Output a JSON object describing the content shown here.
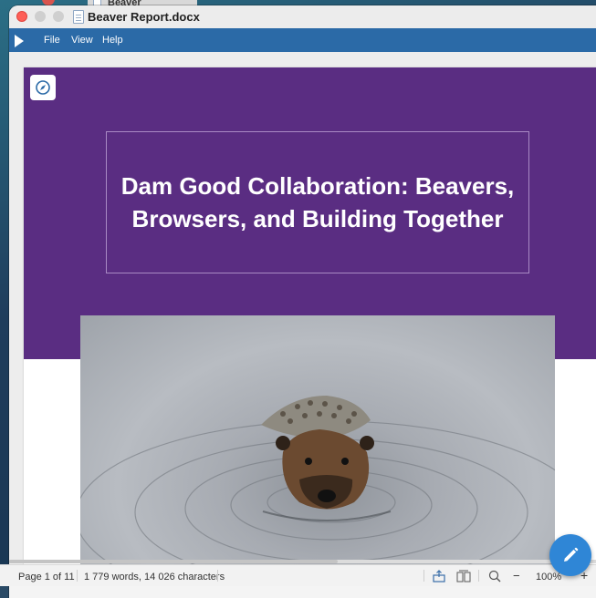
{
  "background_window": {
    "title": "Beaver Report.docx"
  },
  "window": {
    "title": "Beaver Report.docx"
  },
  "menu": {
    "items": [
      "File",
      "View",
      "Help"
    ]
  },
  "document": {
    "title": "Dam Good Collaboration: Beavers, Browsers, and Building Together"
  },
  "status": {
    "page": "Page 1 of 11",
    "counts": "1 779 words, 14 026 characters",
    "zoom": "100%",
    "zoom_minus": "−",
    "zoom_plus": "+"
  },
  "colors": {
    "banner": "#5a2d82",
    "menubar": "#2b6aa7",
    "fab": "#2f86d6"
  }
}
